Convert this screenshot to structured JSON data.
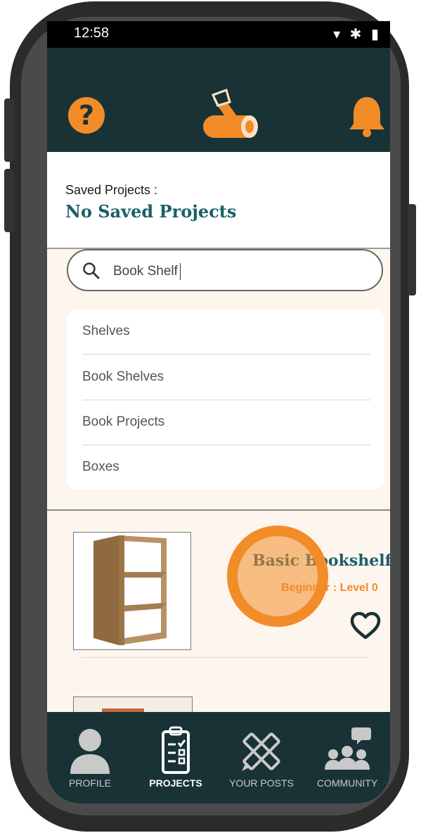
{
  "status_bar": {
    "time": "12:58",
    "icons": "▾ ✱ ▮"
  },
  "header": {
    "help_icon": "question-mark",
    "help_glyph": "?",
    "logo_icon": "axe-log-logo",
    "notification_icon": "bell-icon"
  },
  "saved": {
    "label": "Saved Projects :",
    "value": "No Saved Projects"
  },
  "search": {
    "value": "Book Shelf",
    "icon": "search-icon"
  },
  "suggestions": [
    "Shelves",
    "Book Shelves",
    "Book Projects",
    "Boxes"
  ],
  "projects": [
    {
      "title": "Basic Bookshelf",
      "level": "Beginner : Level 0",
      "favorite_icon": "heart-outline-icon"
    }
  ],
  "nav": {
    "items": [
      {
        "label": "PROFILE",
        "icon": "person-icon",
        "active": false
      },
      {
        "label": "PROJECTS",
        "icon": "clipboard-icon",
        "active": true
      },
      {
        "label": "YOUR POSTS",
        "icon": "pencil-ruler-icon",
        "active": false
      },
      {
        "label": "COMMUNITY",
        "icon": "community-icon",
        "active": false
      }
    ]
  },
  "colors": {
    "header_bg": "#183236",
    "accent": "#f28c28",
    "title_teal": "#1b5f6b",
    "page_bg": "#fdf6ef"
  }
}
